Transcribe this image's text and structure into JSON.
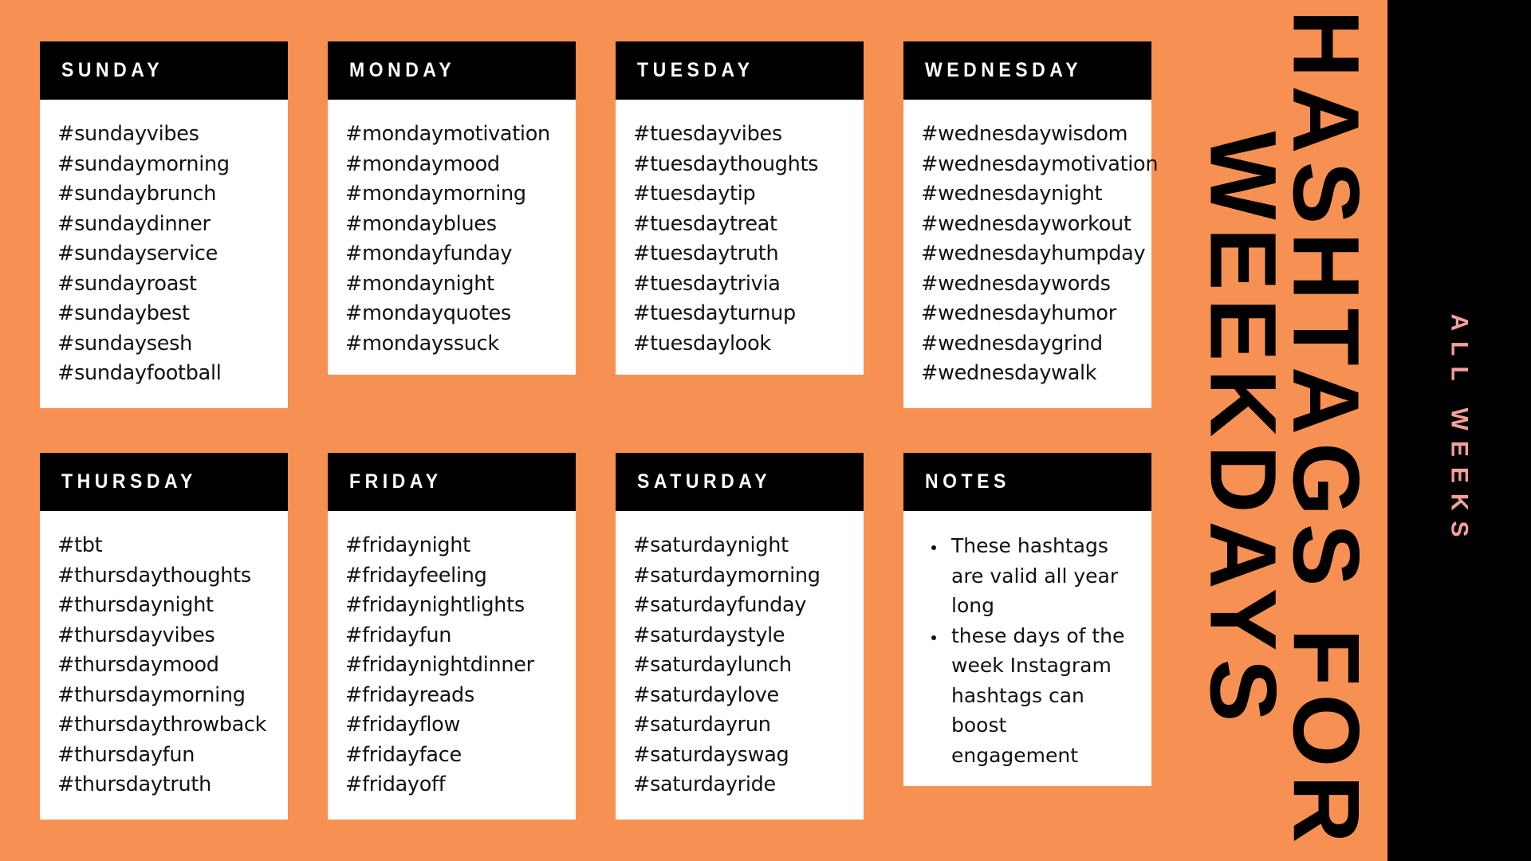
{
  "background_color": "#F79153",
  "accent_color": "#000000",
  "strip_text_color": "#F4A09A",
  "headline": {
    "line1": "HASHTAGS FOR",
    "line2": "WEEKDAYS"
  },
  "side_strip": {
    "label": "ALL WEEKS"
  },
  "cards": [
    {
      "title": "SUNDAY",
      "type": "tags",
      "items": [
        "#sundayvibes",
        "#sundaymorning",
        "#sundaybrunch",
        "#sundaydinner",
        "#sundayservice",
        "#sundayroast",
        "#sundaybest",
        "#sundaysesh",
        "#sundayfootball"
      ]
    },
    {
      "title": "MONDAY",
      "type": "tags",
      "items": [
        "#mondaymotivation",
        "#mondaymood",
        "#mondaymorning",
        "#mondayblues",
        "#mondayfunday",
        "#mondaynight",
        "#mondayquotes",
        "#mondayssuck"
      ]
    },
    {
      "title": "TUESDAY",
      "type": "tags",
      "items": [
        "#tuesdayvibes",
        "#tuesdaythoughts",
        "#tuesdaytip",
        "#tuesdaytreat",
        "#tuesdaytruth",
        "#tuesdaytrivia",
        "#tuesdayturnup",
        "#tuesdaylook"
      ]
    },
    {
      "title": "WEDNESDAY",
      "type": "tags",
      "items": [
        "#wednesdaywisdom",
        "#wednesdaymotivation",
        "#wednesdaynight",
        "#wednesdayworkout",
        "#wednesdayhumpday",
        "#wednesdaywords",
        "#wednesdayhumor",
        "#wednesdaygrind",
        "#wednesdaywalk"
      ]
    },
    {
      "title": "THURSDAY",
      "type": "tags",
      "items": [
        "#tbt",
        "#thursdaythoughts",
        "#thursdaynight",
        "#thursdayvibes",
        "#thursdaymood",
        "#thursdaymorning",
        "#thursdaythrowback",
        "#thursdayfun",
        "#thursdaytruth"
      ]
    },
    {
      "title": "FRIDAY",
      "type": "tags",
      "items": [
        "#fridaynight",
        "#fridayfeeling",
        "#fridaynightlights",
        "#fridayfun",
        "#fridaynightdinner",
        "#fridayreads",
        "#fridayflow",
        "#fridayface",
        "#fridayoff"
      ]
    },
    {
      "title": "SATURDAY",
      "type": "tags",
      "items": [
        "#saturdaynight",
        "#saturdaymorning",
        "#saturdayfunday",
        "#saturdaystyle",
        "#saturdaylunch",
        "#saturdaylove",
        "#saturdayrun",
        "#saturdayswag",
        "#saturdayride"
      ]
    },
    {
      "title": "NOTES",
      "type": "notes",
      "items": [
        "These hashtags are valid all year long",
        "these days of the week Instagram hashtags can boost engagement"
      ]
    }
  ]
}
